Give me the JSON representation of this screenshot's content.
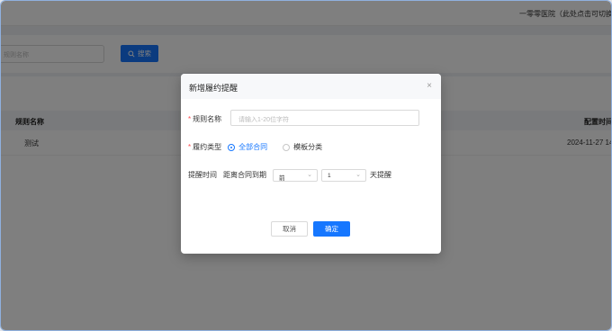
{
  "header": {
    "hospital_text": "一零零医院（此处点击可切换"
  },
  "filter": {
    "input_placeholder": "规则名称",
    "search_label": "搜索"
  },
  "table": {
    "columns": [
      "规则名称",
      "配置时间"
    ],
    "rows": [
      {
        "name": "测试",
        "time": "2024-11-27 14"
      }
    ]
  },
  "modal": {
    "title": "新增履约提醒",
    "close_glyph": "×",
    "rule_name_label": "规则名称",
    "rule_name_placeholder": "请输入1-20位字符",
    "type_label": "履约类型",
    "type_options": [
      "全部合同",
      "模板分类"
    ],
    "type_selected": "全部合同",
    "remind_label": "提醒时间",
    "remind_prefix": "距离合同到期",
    "remind_direction": "前",
    "remind_days": "1",
    "remind_suffix": "天提醒",
    "cancel_label": "取消",
    "confirm_label": "确定"
  },
  "colors": {
    "primary": "#1677ff",
    "required": "#ff4d4f"
  }
}
